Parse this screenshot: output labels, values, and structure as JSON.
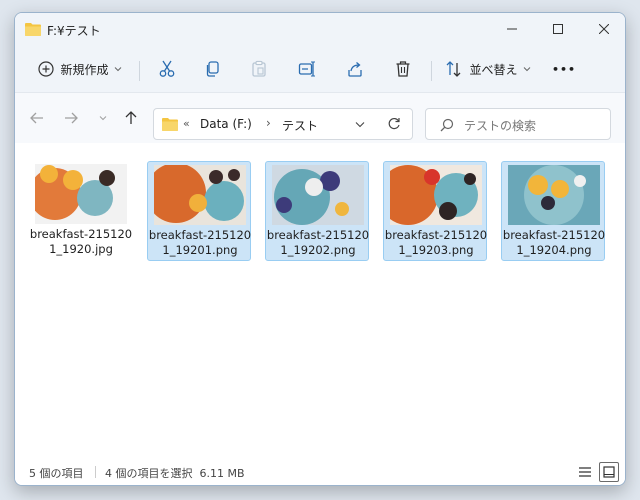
{
  "window": {
    "title": "F:¥テスト"
  },
  "toolbar": {
    "new_label": "新規作成",
    "sort_label": "並べ替え",
    "more_label": "•••"
  },
  "address": {
    "overflow": "«",
    "drive": "Data (F:)",
    "separator": "›",
    "folder": "テスト"
  },
  "search": {
    "placeholder": "テストの検索"
  },
  "files": [
    {
      "name": "breakfast-2151201_1920.jpg",
      "selected": false,
      "palette": [
        "#e27a3a",
        "#7fb6c1",
        "#f2f2f2",
        "#3a2b26",
        "#f3b23a"
      ]
    },
    {
      "name": "breakfast-2151201_19201.png",
      "selected": true,
      "palette": [
        "#d8692c",
        "#6bb0be",
        "#e9e4dc",
        "#3b2a2a",
        "#f1b03b"
      ]
    },
    {
      "name": "breakfast-2151201_19202.png",
      "selected": true,
      "palette": [
        "#cfd9e2",
        "#65a7b6",
        "#eeeeee",
        "#3d3b7a",
        "#f0b63e"
      ]
    },
    {
      "name": "breakfast-2151201_19203.png",
      "selected": true,
      "palette": [
        "#d9672b",
        "#6fb2bf",
        "#f0e8df",
        "#2e2424",
        "#d8352b"
      ]
    },
    {
      "name": "breakfast-2151201_19204.png",
      "selected": true,
      "palette": [
        "#6aa7b8",
        "#8fc2cc",
        "#f0f0f0",
        "#2d2a3a",
        "#f2b53a"
      ]
    }
  ],
  "status": {
    "item_count": "5 個の項目",
    "selection": "4 個の項目を選択  6.11 MB"
  }
}
